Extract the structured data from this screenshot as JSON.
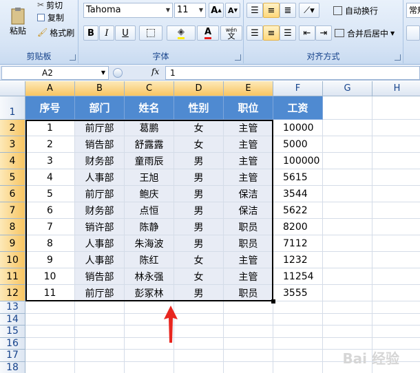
{
  "ribbon": {
    "clipboard": {
      "paste": "粘贴",
      "cut": "剪切",
      "copy": "复制",
      "format_painter": "格式刷",
      "label": "剪贴板"
    },
    "font": {
      "name": "Tahoma",
      "size": "11",
      "bold": "B",
      "italic": "I",
      "underline": "U",
      "font_color": "A",
      "wen": "wén",
      "wen_char": "文",
      "label": "字体"
    },
    "alignment": {
      "wrap_text": "自动换行",
      "merge_center": "合并后居中",
      "label": "对齐方式"
    },
    "number": {
      "format": "常规"
    }
  },
  "formula_bar": {
    "cell_ref": "A2",
    "fx": "fx",
    "value": "1"
  },
  "columns": [
    "A",
    "B",
    "C",
    "D",
    "E",
    "F",
    "G",
    "H"
  ],
  "rows": [
    "1",
    "2",
    "3",
    "4",
    "5",
    "6",
    "7",
    "8",
    "9",
    "10",
    "11",
    "12",
    "13",
    "14",
    "15",
    "16",
    "17",
    "18"
  ],
  "table": {
    "headers": [
      "序号",
      "部门",
      "姓名",
      "性别",
      "职位",
      "工资"
    ],
    "data": [
      [
        "1",
        "前厅部",
        "葛鹏",
        "女",
        "主管",
        "10000"
      ],
      [
        "2",
        "销告部",
        "舒露露",
        "女",
        "主管",
        "5000"
      ],
      [
        "3",
        "财务部",
        "童雨辰",
        "男",
        "主管",
        "100000"
      ],
      [
        "4",
        "人事部",
        "王旭",
        "男",
        "主管",
        "5615"
      ],
      [
        "5",
        "前厅部",
        "鲍庆",
        "男",
        "保洁",
        "3544"
      ],
      [
        "6",
        "财务部",
        "点恒",
        "男",
        "保洁",
        "5622"
      ],
      [
        "7",
        "销许部",
        "陈静",
        "男",
        "职员",
        "8200"
      ],
      [
        "8",
        "人事部",
        "朱海波",
        "男",
        "职员",
        "7112"
      ],
      [
        "9",
        "人事部",
        "陈红",
        "女",
        "主管",
        "1232"
      ],
      [
        "10",
        "销告部",
        "林永强",
        "女",
        "主管",
        "11254"
      ],
      [
        "11",
        "前厅部",
        "彭冢林",
        "男",
        "职员",
        "3555"
      ]
    ]
  },
  "colors": {
    "header_fill": "#4f8ad1",
    "body_fill": "#e8ecf5",
    "arrow": "#e8261f"
  },
  "watermark": "Bai 经验"
}
